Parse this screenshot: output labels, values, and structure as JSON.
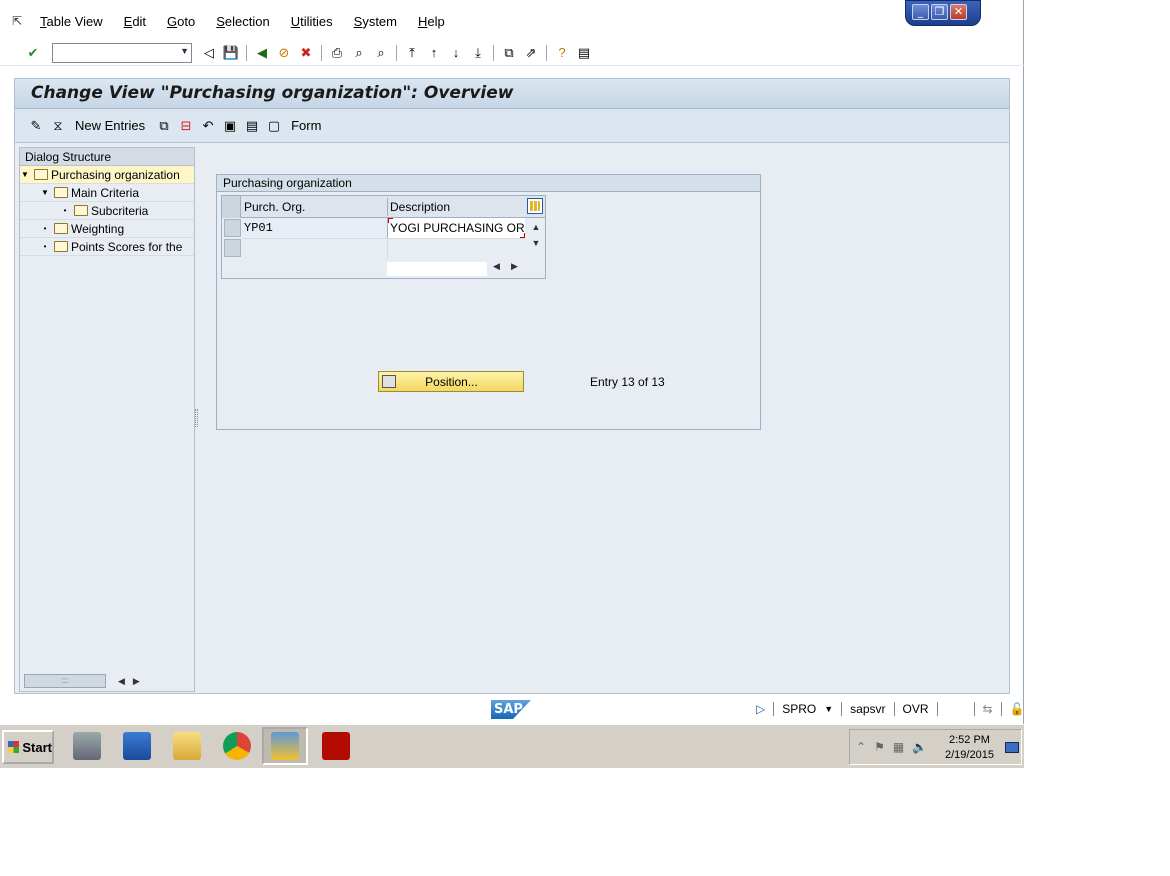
{
  "menu": {
    "items": [
      {
        "label": "Table View",
        "u": "T",
        "rest": "able View"
      },
      {
        "label": "Edit",
        "u": "E",
        "rest": "dit"
      },
      {
        "label": "Goto",
        "u": "G",
        "rest": "oto"
      },
      {
        "label": "Selection",
        "u": "S",
        "rest": "election"
      },
      {
        "label": "Utilities",
        "u": "U",
        "rest": "tilities"
      },
      {
        "label": "System",
        "u": "S",
        "rest": "ystem"
      },
      {
        "label": "Help",
        "u": "H",
        "rest": "elp"
      }
    ]
  },
  "toolbar": {
    "command_value": ""
  },
  "page": {
    "title": "Change View \"Purchasing organization\": Overview"
  },
  "app_toolbar": {
    "new_entries": "New Entries",
    "form": "Form"
  },
  "tree": {
    "header": "Dialog Structure",
    "items": [
      {
        "label": "Purchasing organization",
        "selected": true
      },
      {
        "label": "Main Criteria"
      },
      {
        "label": "Subcriteria"
      },
      {
        "label": "Weighting"
      },
      {
        "label": "Points Scores for the"
      }
    ]
  },
  "group": {
    "title": "Purchasing organization",
    "columns": [
      "Purch. Org.",
      "Description"
    ],
    "rows": [
      {
        "org": "YP01",
        "description": "YOGI PURCHASING ORG"
      }
    ],
    "position_button": "Position...",
    "entry_info": "Entry 13 of 13"
  },
  "status": {
    "logo": "SAP",
    "transaction": "SPRO",
    "server": "sapsvr",
    "mode": "OVR"
  },
  "taskbar": {
    "start": "Start",
    "time": "2:52 PM",
    "date": "2/19/2015"
  },
  "colors": {
    "title_bg": "#c5d6e6",
    "frame_bg": "#e8edf3",
    "selected_row": "#fff6c8",
    "position_button": "#f3d860"
  }
}
